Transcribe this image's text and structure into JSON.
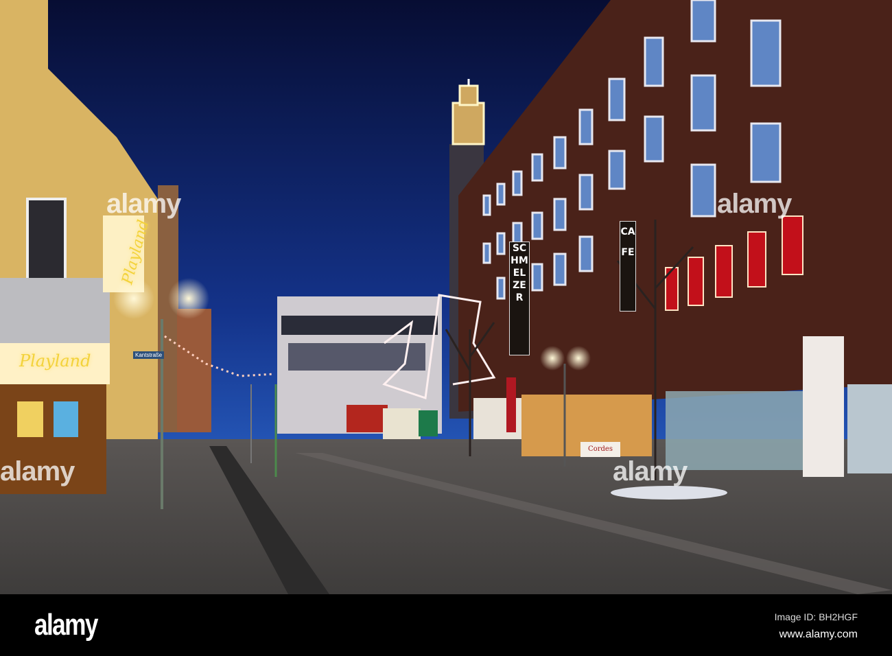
{
  "photo": {
    "signs": {
      "playland_upper": "Playland",
      "playland_lower": "Playland",
      "street_sign": "Kantstraße",
      "schmelzer": "SCHMELZER",
      "cafe": "CAFE",
      "cordes": "Cordes"
    },
    "watermark": "alamy"
  },
  "footer": {
    "logo": "alamy",
    "image_id": "Image ID: BH2HGF",
    "url": "www.alamy.com"
  },
  "colors": {
    "sky_top": "#070d33",
    "sky_bottom": "#1d47a6",
    "brick": "#4a2219",
    "pavement": "#4a4846"
  }
}
